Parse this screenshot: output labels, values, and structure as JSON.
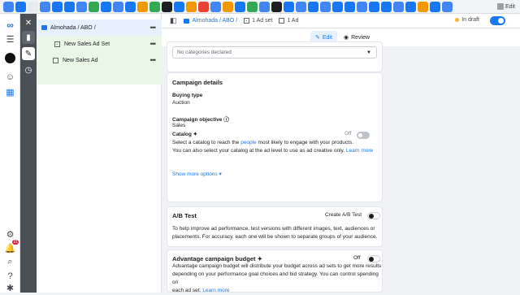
{
  "bookmarks_bar": {
    "edit_label": "Edit",
    "colors": [
      "#4285f4",
      "#1877f2",
      "#e8eaed",
      "#4285f4",
      "#1877f2",
      "#1877f2",
      "#4285f4",
      "#34a853",
      "#1877f2",
      "#4285f4",
      "#1877f2",
      "#f29900",
      "#34a853",
      "#1c1e21",
      "#1877f2",
      "#f29900",
      "#ea4335",
      "#4285f4",
      "#f29900",
      "#1877f2",
      "#34a853",
      "#4285f4",
      "#1c1e21",
      "#1877f2",
      "#4285f4",
      "#1877f2",
      "#4285f4",
      "#1877f2",
      "#1877f2",
      "#4285f4",
      "#1877f2",
      "#1877f2",
      "#4285f4",
      "#1877f2",
      "#f29900",
      "#1877f2",
      "#4285f4"
    ]
  },
  "tree": {
    "campaign": "Almohada / ABO /",
    "ad_set": "New Sales Ad Set",
    "ad": "New Sales Ad"
  },
  "breadcrumb": {
    "campaign": "Almohada / ABO /",
    "ad_sets": "1 Ad set",
    "ads": "1 Ad"
  },
  "status": {
    "label": "In draft"
  },
  "modes": {
    "edit": "Edit",
    "review": "Review"
  },
  "categories": {
    "select_value": "No categories declared"
  },
  "campaign_details": {
    "title": "Campaign details",
    "buying_type_label": "Buying type",
    "buying_type_value": "Auction",
    "objective_label": "Campaign objective",
    "objective_value": "Sales",
    "catalog_label": "Catalog",
    "catalog_toggle": "Off",
    "catalog_desc_1": "Select a catalog to reach the",
    "catalog_desc_link": "people",
    "catalog_desc_2": "most likely to engage with your products.",
    "catalog_desc_3": "You can also select your catalog at the ad level to use as ad creative only.",
    "learn_more": "Learn more",
    "show_more": "Show more options"
  },
  "ab_test": {
    "title": "A/B Test",
    "create_label": "Create A/B Test",
    "desc_1": "To help improve ad performance, test versions with different images, text, audiences or",
    "desc_2": "placements. For accuracy, each one will be shown to separate groups of your audience."
  },
  "advantage_budget": {
    "title": "Advantage campaign budget",
    "toggle": "Off",
    "desc_1": "Advantage campaign budget will distribute your budget across ad sets to get more results",
    "desc_2": "depending on your performance goal choices and bid strategy. You can control spending on",
    "desc_3": "each ad set.",
    "learn_more": "Learn more"
  },
  "rail": {
    "notification_count": "21"
  }
}
